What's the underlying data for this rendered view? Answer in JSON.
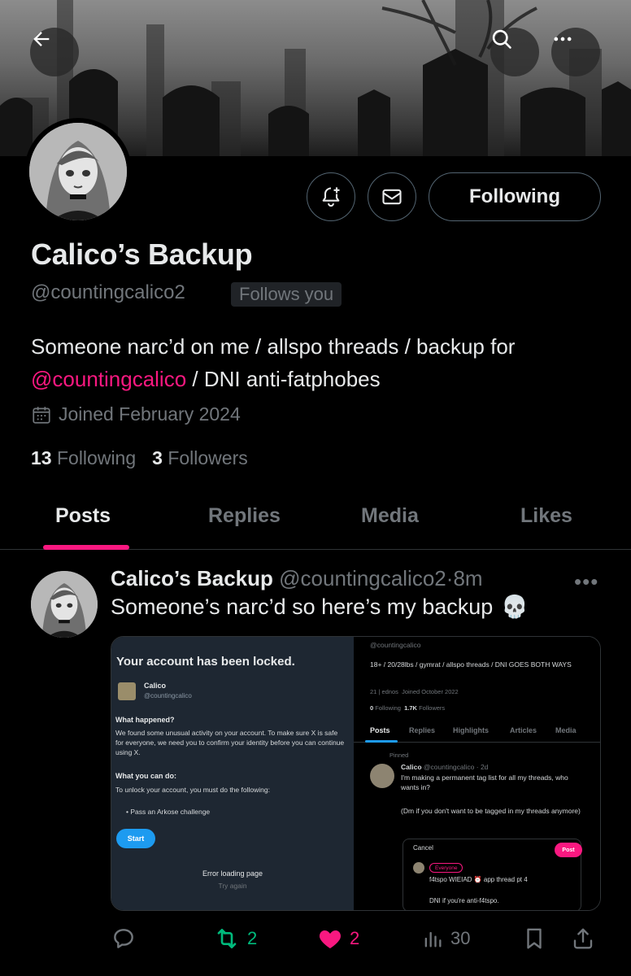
{
  "header": {
    "back_icon": "arrow-left-icon",
    "search_icon": "search-icon",
    "more_icon": "more-horizontal-icon"
  },
  "profile": {
    "display_name": "Calico’s Backup",
    "handle": "@countingcalico2",
    "follows_you": "Follows you",
    "following_label": "Following",
    "bio_prefix": "Someone narc’d on me / allspo threads / backup for",
    "bio_mention": "@countingcalico",
    "bio_suffix": " / DNI anti-fatphobes",
    "joined": "Joined February 2024",
    "following_count": "13",
    "following_label_stat": "Following",
    "followers_count": "3",
    "followers_label_stat": "Followers"
  },
  "tabs": [
    {
      "label": "Posts",
      "active": true
    },
    {
      "label": "Replies",
      "active": false
    },
    {
      "label": "Media",
      "active": false
    },
    {
      "label": "Likes",
      "active": false
    }
  ],
  "post": {
    "author_name": "Calico’s Backup",
    "author_handle": "@countingcalico2",
    "separator": "·",
    "time": "8m",
    "text": "Someone’s narc’d so here’s my backup",
    "emoji": "💀",
    "actions": {
      "reply_count": "",
      "repost_count": "2",
      "like_count": "2",
      "views_count": "30"
    }
  },
  "embedded": {
    "left": {
      "title": "Your account has been locked.",
      "name": "Calico",
      "handle": "@countingcalico",
      "what_happened_h": "What happened?",
      "what_happened_p": "We found some unusual activity on your account. To make sure X is safe for everyone, we need you to confirm your identity before you can continue using X.",
      "what_do_h": "What you can do:",
      "what_do_p": "To unlock your account, you must do the following:",
      "bullet": "•   Pass an Arkose challenge",
      "start": "Start",
      "error": "Error loading page",
      "try_again": "Try again"
    },
    "right": {
      "handle": "@countingcalico",
      "bio": "18+ / 20/28lbs / gymrat / allspo threads / DNI GOES BOTH WAYS",
      "location": "21 | ednos",
      "joined": "Joined October 2022",
      "following": "0",
      "following_label": "Following",
      "followers": "1.7K",
      "followers_label": "Followers",
      "tabs": [
        "Posts",
        "Replies",
        "Highlights",
        "Articles",
        "Media"
      ],
      "pinned": "Pinned",
      "post_name": "Calico",
      "post_meta": "@countingcalico · 2d",
      "post_text": "I'm making a permanent tag list for all my threads, who wants in?",
      "post_text2": "(Dm if you don't want to be tagged in my threads anymore)",
      "cancel": "Cancel",
      "post_btn": "Post",
      "everyone": "Everyone",
      "draft1": "f4tspo WIEIAD ⏰ app thread pt 4",
      "draft2": "DNI if you're anti-f4tspo."
    }
  },
  "colors": {
    "accent": "#f91880",
    "repost": "#00ba7c",
    "muted": "#71767b",
    "text": "#e7e9ea"
  }
}
